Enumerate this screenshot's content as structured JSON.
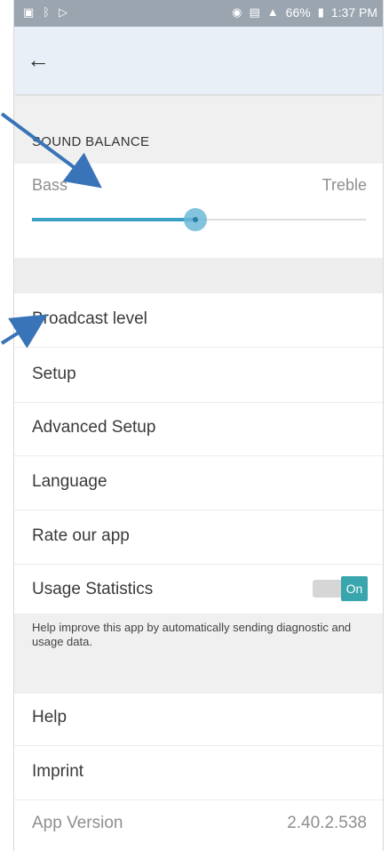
{
  "status_bar": {
    "left_icons": [
      "gallery-icon",
      "bluetooth-icon",
      "play-store-icon"
    ],
    "battery": "66%",
    "time": "1:37 PM"
  },
  "header": {
    "back_icon": "arrow-left-icon"
  },
  "sound_balance": {
    "title": "SOUND BALANCE",
    "left_label": "Bass",
    "right_label": "Treble",
    "value_fraction": 0.49
  },
  "menu": {
    "broadcast_level": "Broadcast level",
    "setup": "Setup",
    "advanced_setup": "Advanced Setup",
    "language": "Language",
    "rate_app": "Rate our app",
    "usage_statistics": "Usage Statistics",
    "usage_toggle": "On",
    "usage_help": "Help improve this app by automatically sending diagnostic and usage data.",
    "help": "Help",
    "imprint": "Imprint",
    "app_version_label": "App Version",
    "app_version_value": "2.40.2.538"
  },
  "colors": {
    "accent": "#3aa0c4",
    "toggle_on": "#39a5ad",
    "annotation_arrow": "#3a74b8"
  }
}
